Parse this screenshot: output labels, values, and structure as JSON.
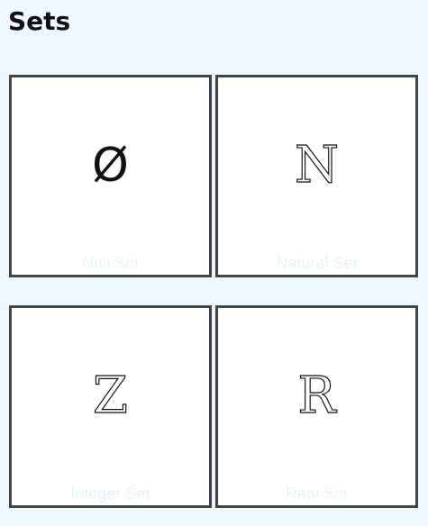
{
  "page": {
    "title": "Sets"
  },
  "cards": [
    {
      "symbol": "Ø",
      "label": "Null Set"
    },
    {
      "symbol": "N",
      "label": "Natural Set"
    },
    {
      "symbol": "Z",
      "label": "Integer Set"
    },
    {
      "symbol": "R",
      "label": "Real Set"
    }
  ],
  "colors": {
    "background": "#eef6ff",
    "card_background": "#ffffff",
    "card_border": "#444444",
    "label_text": "#eaf3fc"
  }
}
